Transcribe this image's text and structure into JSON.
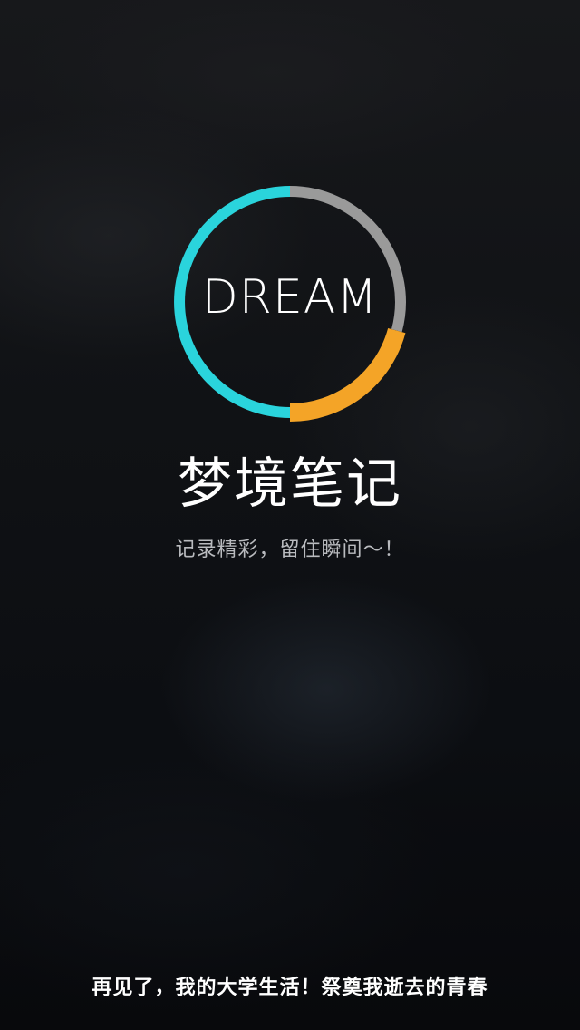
{
  "splash": {
    "logo": {
      "text": "DREAM",
      "ring_colors": {
        "cyan": "#2ad4dc",
        "gray": "#9a9a9a",
        "orange": "#f4a427"
      }
    },
    "title": "梦境笔记",
    "tagline": "记录精彩，留住瞬间～！",
    "footer": "再见了，我的大学生活！祭奠我逝去的青春"
  }
}
